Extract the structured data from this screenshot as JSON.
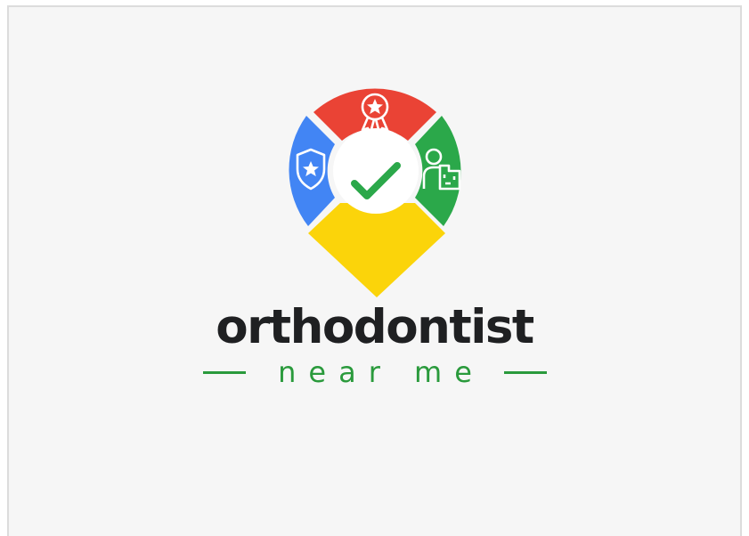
{
  "logo": {
    "wordmark": "orthodontist",
    "tagline": "near me",
    "icons": [
      "award-ribbon-icon",
      "shield-star-icon",
      "person-building-icon",
      "checkmark-icon",
      "map-pin-icon"
    ],
    "colors": {
      "red": "#ea4335",
      "blue": "#4285f4",
      "green": "#2ba84a",
      "yellow": "#fbd40a",
      "ink": "#1f2022",
      "tagline_green": "#2a9a3c",
      "background": "#f6f6f6"
    }
  }
}
